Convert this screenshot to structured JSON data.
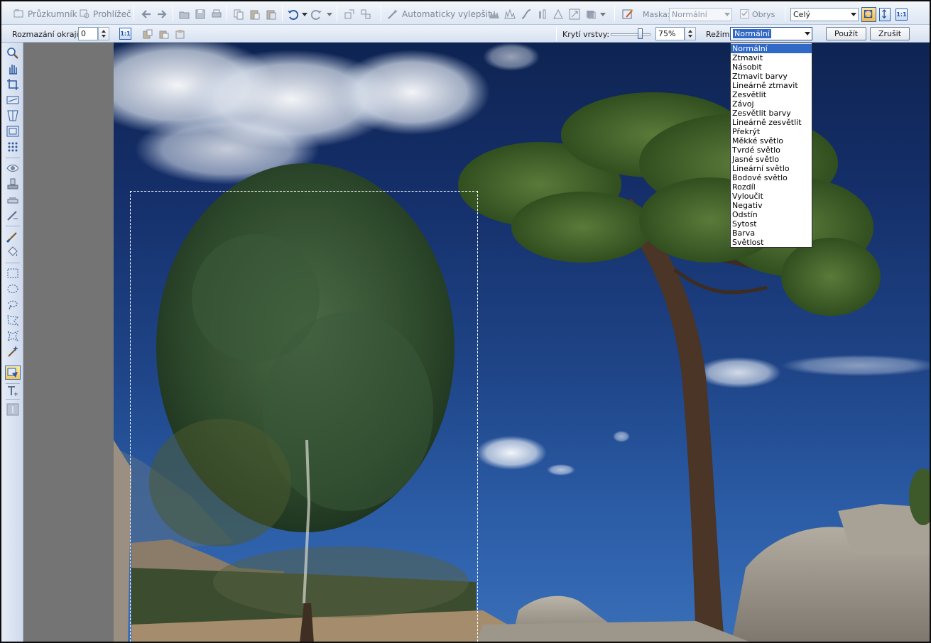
{
  "toolbar": {
    "explorer": "Průzkumník",
    "viewer": "Prohlížeč",
    "auto_enhance": "Automaticky vylepšit",
    "mask_label": "Maska:",
    "mask_value": "Normální",
    "outline_label": "Obrys",
    "view_select": "Celý",
    "actual_size": "1:1"
  },
  "options_bar": {
    "feather_label": "Rozmazání okrajů:",
    "feather_value": "0",
    "actual_size": "1:1",
    "opacity_label": "Krytí vrstvy:",
    "opacity_value": "75%",
    "opacity_fraction": 0.75,
    "mode_label": "Režim:",
    "mode_value": "Normální",
    "apply_button": "Použít",
    "cancel_button": "Zrušit"
  },
  "blend_modes": {
    "selected_index": 0,
    "items": [
      "Normální",
      "Ztmavit",
      "Násobit",
      "Ztmavit barvy",
      "Lineárně ztmavit",
      "Zesvětlit",
      "Závoj",
      "Zesvětlit barvy",
      "Lineárně zesvětlit",
      "Překrýt",
      "Měkké světlo",
      "Tvrdé světlo",
      "Jasné světlo",
      "Lineární světlo",
      "Bodové světlo",
      "Rozdíl",
      "Vyloučit",
      "Negativ",
      "Odstín",
      "Sytost",
      "Barva",
      "Světlost"
    ]
  },
  "colors": {
    "selection_highlight": "#3169c6",
    "canvas_background": "#747474",
    "sky": "#1f4588"
  }
}
